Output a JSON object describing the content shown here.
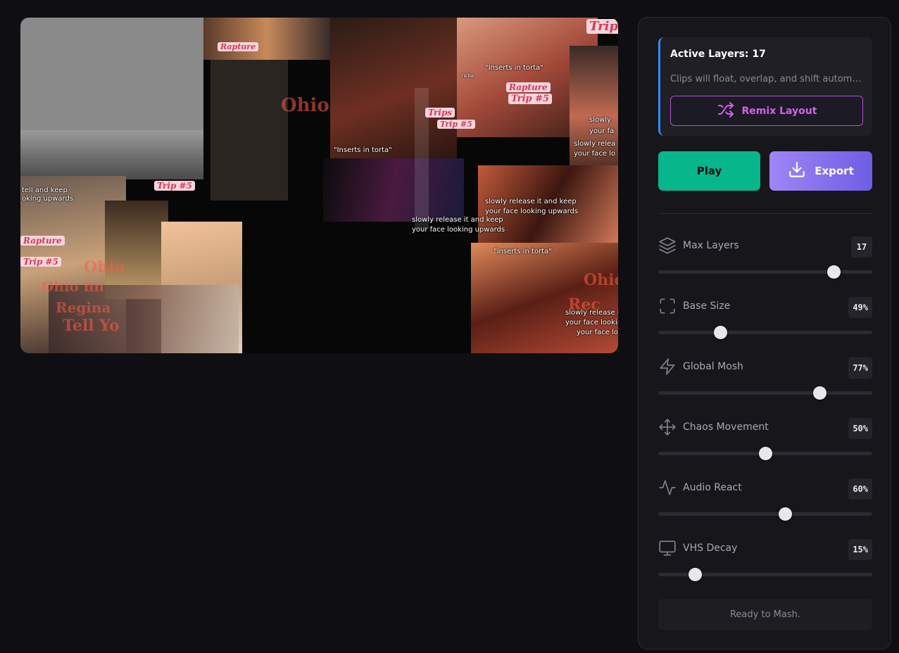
{
  "preview": {
    "captions": [
      "\"Inserts in torta\"",
      "\"Inserts in torta\"",
      "\"Inserts in torta\"",
      "slowly release it and keep",
      "your face looking upwards",
      "slowly release it and keep",
      "your face looking upwards",
      "slowly relea",
      "your face lo",
      "slowly",
      "your fa",
      "slowly release it",
      "your face looking",
      "your face loo",
      "tell and keep",
      "oking upwards",
      "TikTok"
    ],
    "tags": [
      "Trip",
      "Trip #5",
      "Rapture",
      "Trip #5",
      "Trips",
      "Rapture",
      "Trip #5",
      "Rapture",
      "Trip #5"
    ],
    "glow": [
      "Ohio",
      "Ohio fin",
      "Regina",
      "Tell Yo",
      "Ohio",
      "Rec",
      "Ohio"
    ]
  },
  "info": {
    "title": "Active Layers: 17",
    "description": "Clips will float, overlap, and shift automatically.",
    "remix_label": "Remix Layout"
  },
  "actions": {
    "play_label": "Play",
    "export_label": "Export"
  },
  "controls": [
    {
      "label": "Max Layers",
      "value": "17",
      "icon": "layers-icon",
      "fraction": 0.82
    },
    {
      "label": "Base Size",
      "value": "49%",
      "icon": "frame-icon",
      "fraction": 0.29
    },
    {
      "label": "Global Mosh",
      "value": "77%",
      "icon": "lightning-icon",
      "fraction": 0.753
    },
    {
      "label": "Chaos Movement",
      "value": "50%",
      "icon": "move-icon",
      "fraction": 0.5
    },
    {
      "label": "Audio React",
      "value": "60%",
      "icon": "activity-icon",
      "fraction": 0.592
    },
    {
      "label": "VHS Decay",
      "value": "15%",
      "icon": "monitor-icon",
      "fraction": 0.171
    }
  ],
  "status": "Ready to Mash.",
  "colors": {
    "accent_blue": "#2f8cff",
    "remix": "#d560ef",
    "play": "#08b68c",
    "export_from": "#9f86f6",
    "export_to": "#6f5de4"
  }
}
